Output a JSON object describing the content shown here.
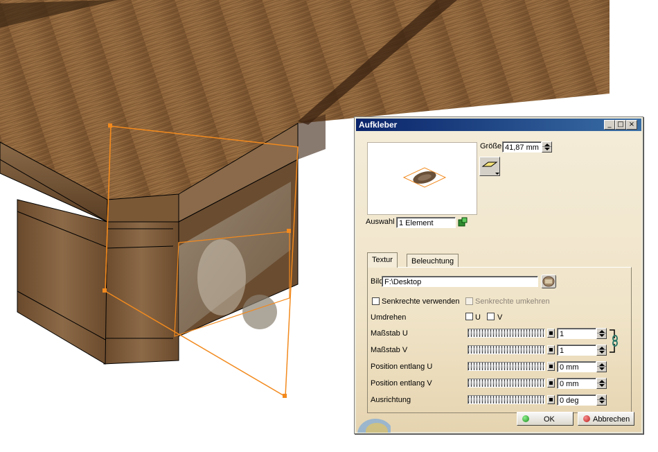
{
  "dialog": {
    "title": "Aufkleber",
    "size_label": "Größe",
    "size_value": "41,87 mm",
    "selection_label": "Auswahl",
    "selection_value": "1 Element",
    "tabs": [
      {
        "label": "Textur",
        "active": true
      },
      {
        "label": "Beleuchtung",
        "active": false
      }
    ],
    "image_label": "Bild",
    "image_path": "F:\\Desktop",
    "checkbox_perpendicular": "Senkrechte verwenden",
    "checkbox_invert_perpendicular": "Senkrechte umkehren",
    "flip_label": "Umdrehen",
    "flip_u": "U",
    "flip_v": "V",
    "scale_u_label": "Maßstab U",
    "scale_u_value": "1",
    "scale_v_label": "Maßstab V",
    "scale_v_value": "1",
    "pos_u_label": "Position entlang U",
    "pos_u_value": "0 mm",
    "pos_v_label": "Position entlang V",
    "pos_v_value": "0 mm",
    "orientation_label": "Ausrichtung",
    "orientation_value": "0 deg",
    "ok_label": "OK",
    "cancel_label": "Abbrechen"
  },
  "colors": {
    "title_bar": "#0a246a",
    "selection_outline": "#f28a1e",
    "wood": "#7a5530"
  },
  "icons": [
    "minimize-icon",
    "maximize-icon",
    "close-icon",
    "decal-plane-icon",
    "selection-icon",
    "browse-icon",
    "link-icon",
    "ok-icon",
    "cancel-icon"
  ]
}
